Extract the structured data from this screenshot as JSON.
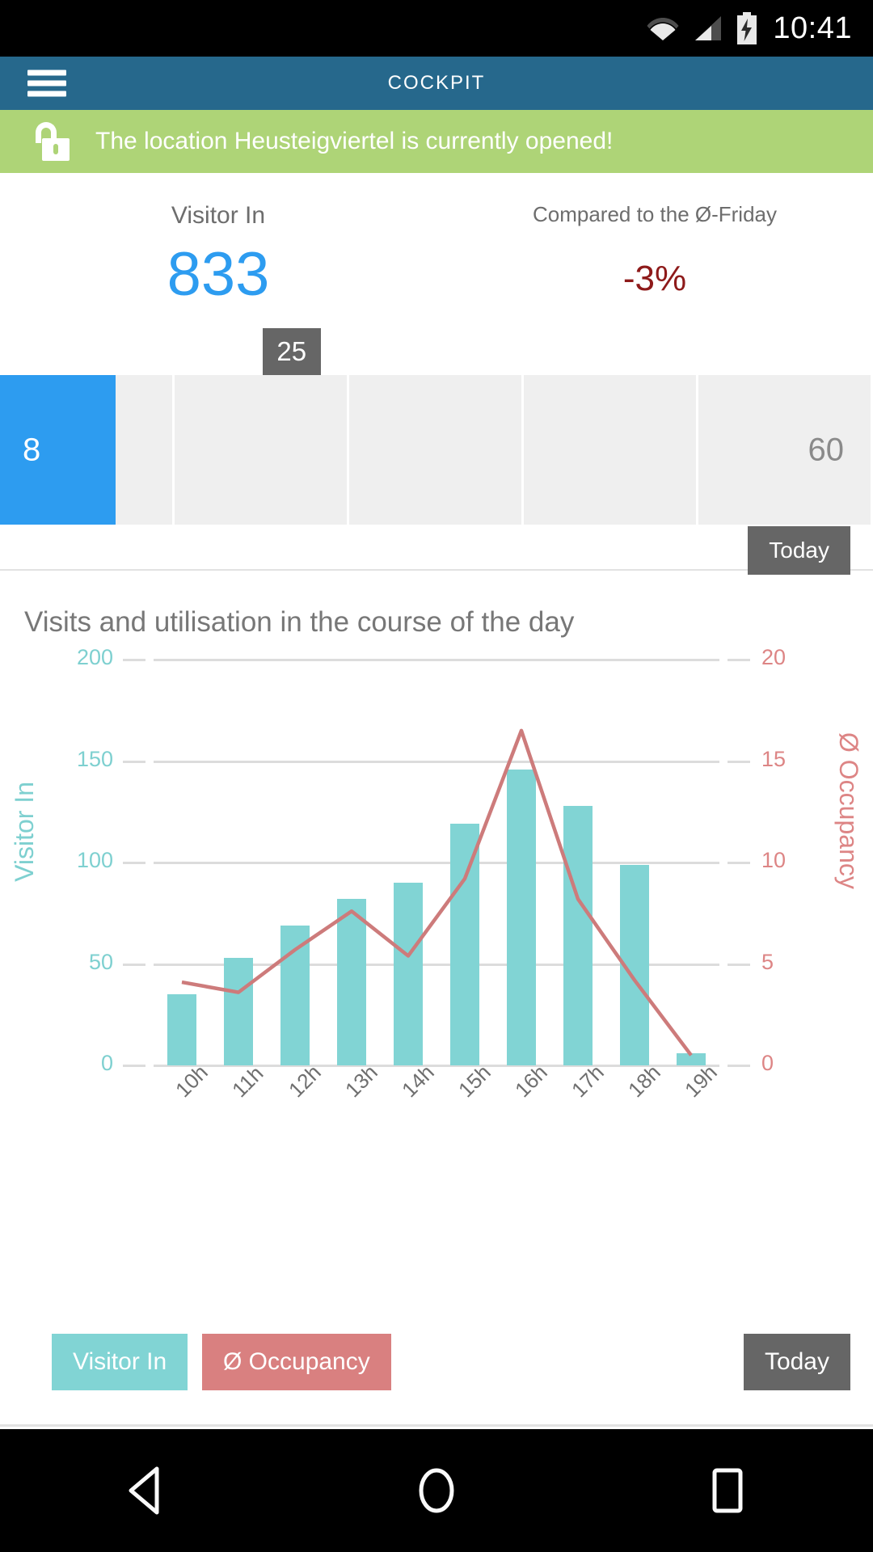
{
  "status_bar": {
    "time": "10:41",
    "icons": [
      "wifi-icon",
      "cellular-signal-icon",
      "battery-charging-icon"
    ]
  },
  "app_bar": {
    "title": "COCKPIT",
    "menu_icon": "hamburger-menu-icon"
  },
  "banner": {
    "icon": "unlock-icon",
    "message": "The location Heusteigviertel is currently opened!",
    "color": "#aed477"
  },
  "stats": {
    "visitor_in": {
      "label": "Visitor In",
      "value": "833",
      "color": "#2d9cf0"
    },
    "comparison": {
      "label": "Compared to the Ø-Friday",
      "value": "-3%",
      "color": "#8e1a1a"
    }
  },
  "occupancy_bar": {
    "marker_value": "25",
    "marker_position_pct": 33.4,
    "min_label": "8",
    "max_label": "60",
    "filled_pct": 13.2,
    "segments": 5,
    "today_label": "Today",
    "filled_color": "#2d9cf0",
    "empty_color": "#efefef"
  },
  "chart_section": {
    "title": "Visits and utilisation in the course of the day",
    "legend": [
      {
        "label": "Visitor In",
        "color": "#81d4d4"
      },
      {
        "label": "Ø Occupancy",
        "color": "#d98080"
      }
    ],
    "today_label": "Today"
  },
  "chart_data": {
    "type": "bar",
    "title": "Visits and utilisation in the course of the day",
    "xlabel": "",
    "categories": [
      "10h",
      "11h",
      "12h",
      "13h",
      "14h",
      "15h",
      "16h",
      "17h",
      "18h",
      "19h"
    ],
    "series": [
      {
        "name": "Visitor In",
        "type": "bar",
        "axis": "left",
        "color": "#81d4d4",
        "values": [
          35,
          53,
          69,
          82,
          90,
          119,
          146,
          128,
          99,
          6
        ]
      },
      {
        "name": "Ø Occupancy",
        "type": "line",
        "axis": "right",
        "color": "#cd7b7b",
        "values": [
          4.1,
          3.6,
          5.7,
          7.6,
          5.4,
          9.2,
          16.5,
          8.2,
          4.2,
          0.5
        ]
      }
    ],
    "left_axis": {
      "label": "Visitor In",
      "color": "#7ed0d0",
      "ticks": [
        0,
        50,
        100,
        150,
        200
      ],
      "ylim": [
        0,
        200
      ]
    },
    "right_axis": {
      "label": "Ø Occupancy",
      "color": "#dd8585",
      "ticks": [
        0,
        5,
        10,
        15,
        20
      ],
      "ylim": [
        0,
        20
      ]
    },
    "grid": true,
    "legend_position": "bottom-left"
  },
  "nav_bar": {
    "buttons": [
      "back-icon",
      "home-icon",
      "recents-icon"
    ]
  }
}
